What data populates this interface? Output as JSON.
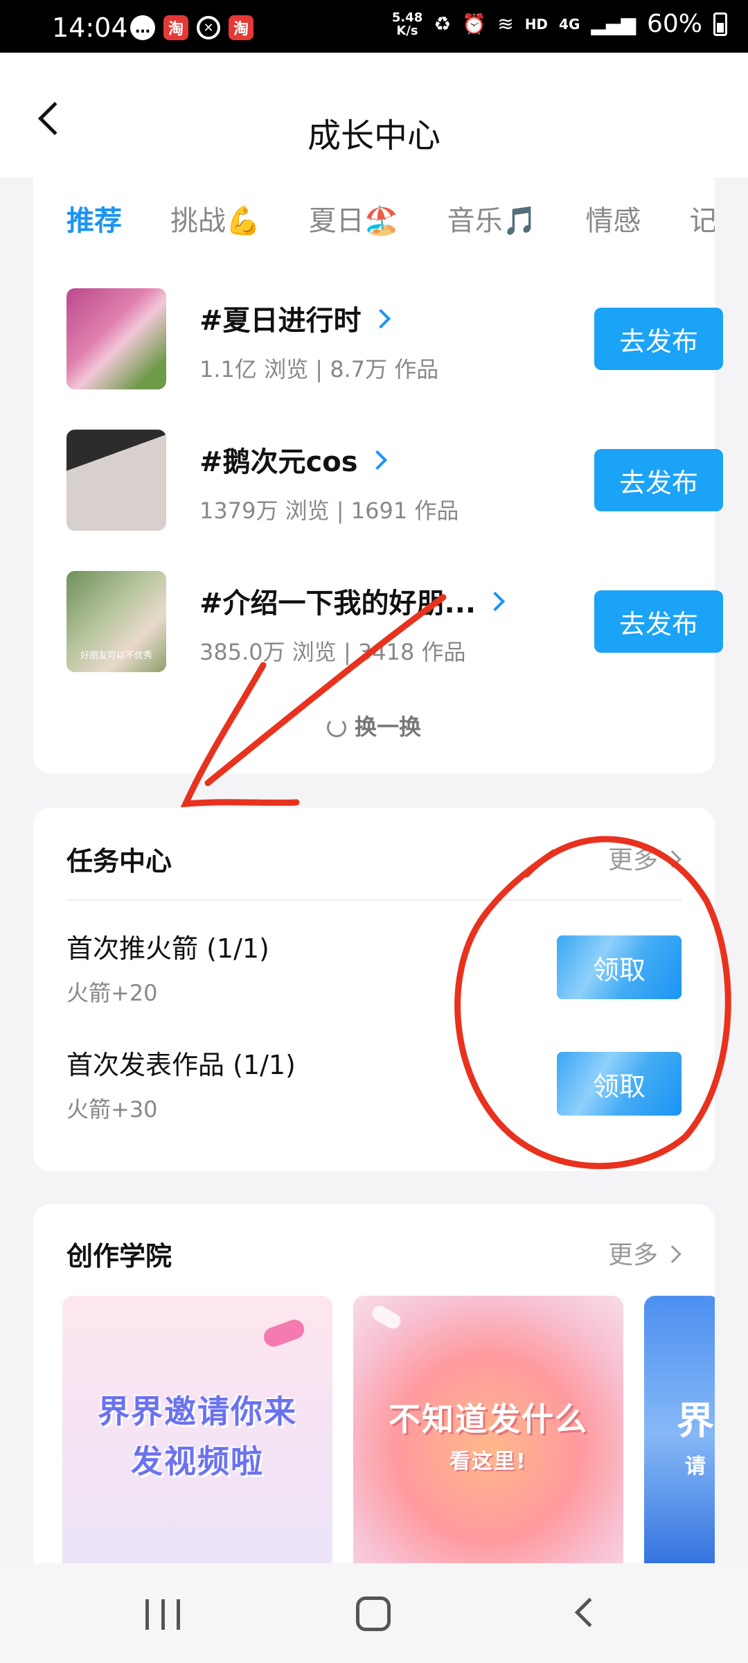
{
  "status_bar": {
    "time": "14:04",
    "speed_value": "5.48",
    "speed_unit": "K/s",
    "network": "4G",
    "hd": "HD",
    "battery": "60%",
    "notif_icons": [
      "chat-icon",
      "taobao-icon",
      "compass-icon",
      "taobao-icon"
    ]
  },
  "header": {
    "title": "成长中心"
  },
  "tabs": [
    "推荐",
    "挑战💪",
    "夏日🏖️",
    "音乐🎵",
    "情感",
    "记"
  ],
  "topics": [
    {
      "title": "#夏日进行时",
      "meta": "1.1亿 浏览 | 8.7万 作品",
      "button": "去发布",
      "thumb_caption": ""
    },
    {
      "title": "#鹅次元cos",
      "meta": "1379万 浏览 | 1691 作品",
      "button": "去发布",
      "thumb_caption": ""
    },
    {
      "title": "#介绍一下我的好朋...",
      "meta": "385.0万 浏览 | 3418 作品",
      "button": "去发布",
      "thumb_caption": "好朋友可以不优秀"
    }
  ],
  "refresh_label": "换一换",
  "task_center": {
    "title": "任务中心",
    "more": "更多",
    "tasks": [
      {
        "name": "首次推火箭 (1/1)",
        "reward": "火箭+20",
        "button": "领取"
      },
      {
        "name": "首次发表作品 (1/1)",
        "reward": "火箭+30",
        "button": "领取"
      }
    ]
  },
  "academy": {
    "title": "创作学院",
    "more": "更多",
    "cards": [
      {
        "line1": "界界邀请你来",
        "line2": "发视频啦"
      },
      {
        "line1": "不知道发什么",
        "line2": "看这里!"
      },
      {
        "line1": "界",
        "line2": "请"
      }
    ]
  },
  "colors": {
    "accent": "#1a94f5",
    "publish_button": "#1aa3f7",
    "annotation_red": "#e8321e"
  }
}
